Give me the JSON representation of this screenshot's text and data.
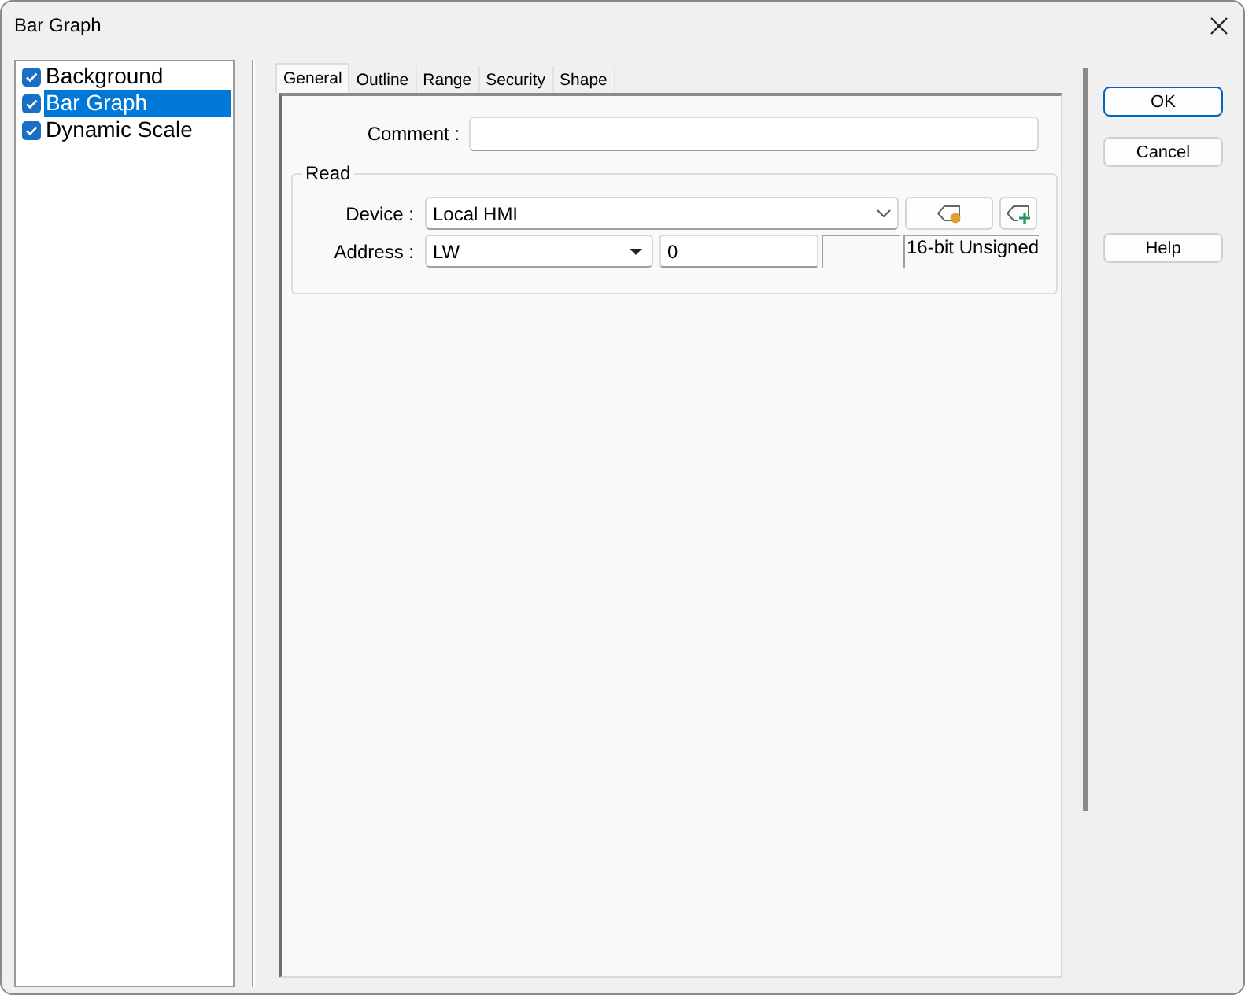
{
  "window": {
    "title": "Bar Graph"
  },
  "sidebar": {
    "items": [
      {
        "label": "Background",
        "checked": true,
        "selected": false
      },
      {
        "label": "Bar Graph",
        "checked": true,
        "selected": true
      },
      {
        "label": "Dynamic Scale",
        "checked": true,
        "selected": false
      }
    ]
  },
  "tabs": [
    {
      "label": "General",
      "selected": true
    },
    {
      "label": "Outline",
      "selected": false
    },
    {
      "label": "Range",
      "selected": false
    },
    {
      "label": "Security",
      "selected": false
    },
    {
      "label": "Shape",
      "selected": false
    }
  ],
  "general": {
    "comment": {
      "label": "Comment :"
    },
    "read": {
      "title": "Read",
      "device": {
        "label": "Device :",
        "value": "Local HMI"
      },
      "address": {
        "label": "Address :",
        "type": "LW",
        "value": "0",
        "data_type": "16-bit Unsigned"
      }
    }
  },
  "buttons": [
    {
      "label": "OK",
      "default": true
    },
    {
      "label": "Cancel",
      "default": false
    },
    {
      "label": "Help",
      "default": false
    }
  ]
}
